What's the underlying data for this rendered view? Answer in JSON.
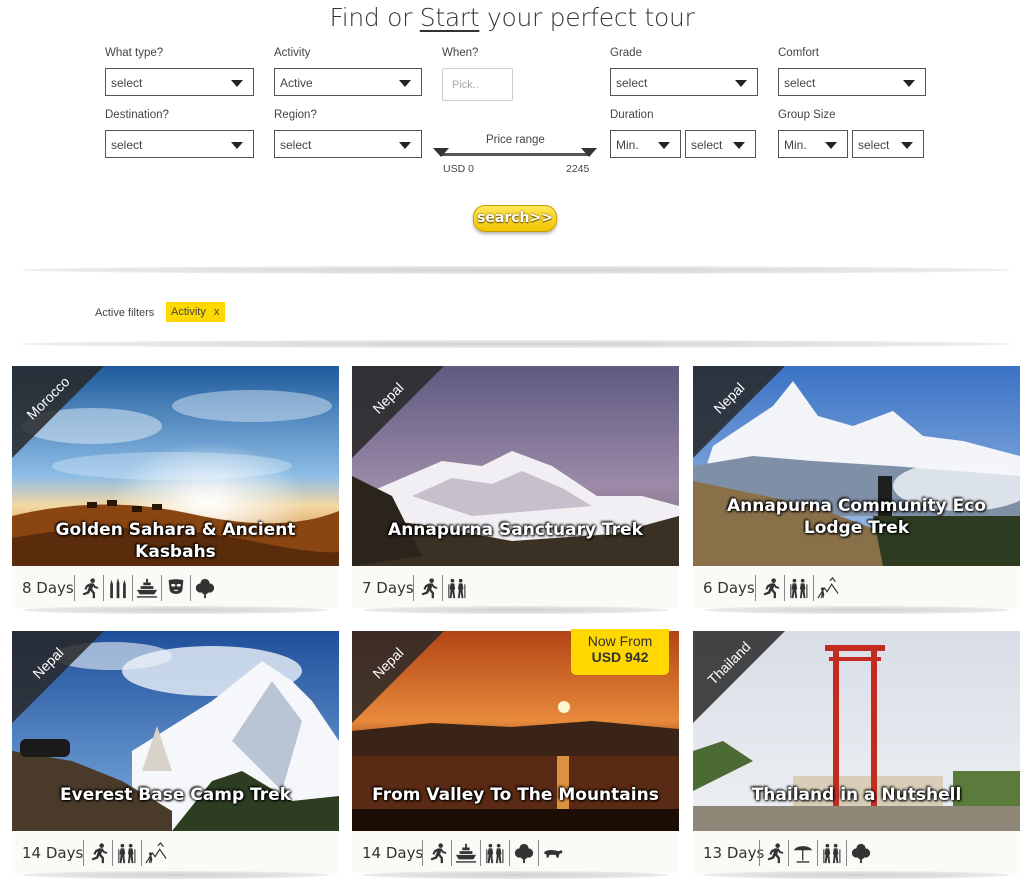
{
  "header": {
    "title_pre": "Find or ",
    "title_underlined": "Start",
    "title_post": " your perfect tour"
  },
  "filters": {
    "what_type": {
      "label": "What type?",
      "value": "select"
    },
    "activity": {
      "label": "Activity",
      "value": "Active"
    },
    "when": {
      "label": "When?",
      "placeholder": "Pick.."
    },
    "grade": {
      "label": "Grade",
      "value": "select"
    },
    "comfort": {
      "label": "Comfort",
      "value": "select"
    },
    "destination": {
      "label": "Destination?",
      "value": "select"
    },
    "region": {
      "label": "Region?",
      "value": "select"
    },
    "price": {
      "label": "Price range",
      "currency": "USD",
      "min": "0",
      "max": "2245"
    },
    "duration": {
      "label": "Duration",
      "min_value": "Min.",
      "max_value": "select"
    },
    "group_size": {
      "label": "Group Size",
      "min_value": "Min.",
      "max_value": "select"
    },
    "search_label": "search>>"
  },
  "active_filters": {
    "label": "Active filters",
    "chips": [
      {
        "label": "Activity",
        "remove": "x"
      }
    ]
  },
  "tours": [
    {
      "country": "Morocco",
      "title": "Golden Sahara & Ancient Kasbahs",
      "days": "8 Days",
      "icons": [
        "running-icon",
        "minarets-icon",
        "cruise-ship-icon",
        "mask-icon",
        "leaf-icon"
      ]
    },
    {
      "country": "Nepal",
      "title": "Annapurna Sanctuary Trek",
      "days": "7 Days",
      "icons": [
        "running-icon",
        "hikers-icon"
      ]
    },
    {
      "country": "Nepal",
      "title": "Annapurna Community Eco Lodge Trek",
      "days": "6 Days",
      "icons": [
        "running-icon",
        "hikers-icon",
        "mountain-hiker-icon"
      ]
    },
    {
      "country": "Nepal",
      "title": "Everest Base Camp Trek",
      "days": "14 Days",
      "icons": [
        "running-icon",
        "hikers-icon",
        "mountain-hiker-icon"
      ]
    },
    {
      "country": "Nepal",
      "title": "From Valley To The Mountains",
      "days": "14 Days",
      "price_line1": "Now From",
      "price_line2": "USD 942",
      "icons": [
        "running-icon",
        "cruise-ship-icon",
        "hikers-icon",
        "leaf-icon",
        "animal-icon"
      ]
    },
    {
      "country": "Thailand",
      "title": "Thailand in a Nutshell",
      "days": "13 Days",
      "icons": [
        "running-icon",
        "beach-umbrella-icon",
        "hikers-icon",
        "leaf-icon"
      ]
    }
  ]
}
